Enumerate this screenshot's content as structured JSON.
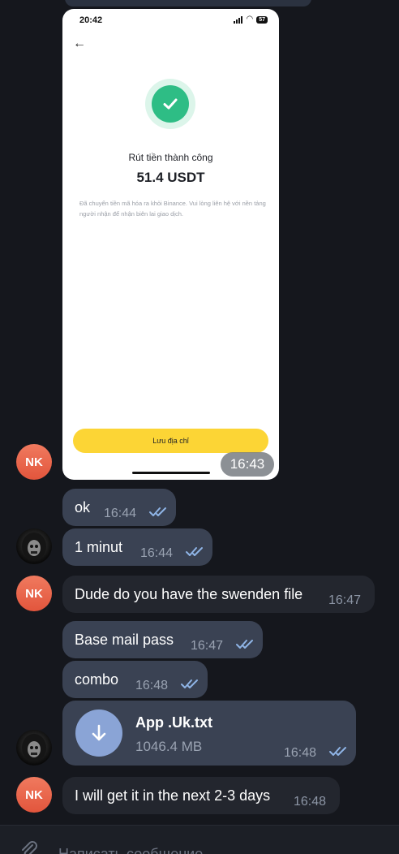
{
  "photo": {
    "status_time": "20:42",
    "battery": "57",
    "title": "Rút tiền thành công",
    "amount": "51.4 USDT",
    "description": "Đã chuyển tiền mã hóa ra khỏi Binance. Vui lòng liên hệ với nền tảng người nhận để nhận biên lai giao dịch.",
    "button_label": "Lưu địa chỉ",
    "time": "16:43"
  },
  "avatars": {
    "nk_initials": "NK"
  },
  "messages": [
    {
      "text": "ok",
      "time": "16:44",
      "outgoing": true
    },
    {
      "text": "1 minut",
      "time": "16:44",
      "outgoing": true
    },
    {
      "text": "Dude do you have the swenden file",
      "time": "16:47",
      "outgoing": false
    },
    {
      "text": "Base mail pass",
      "time": "16:47",
      "outgoing": true
    },
    {
      "text": "combo",
      "time": "16:48",
      "outgoing": true
    },
    {
      "text": "I will get it in the next 2-3 days",
      "time": "16:48",
      "outgoing": false
    }
  ],
  "file_message": {
    "name": "App .Uk.txt",
    "size": "1046.4 MB",
    "time": "16:48"
  },
  "input": {
    "placeholder": "Написать сообщение..."
  },
  "colors": {
    "background": "#15171d",
    "outgoing_bubble": "#3a4253",
    "incoming_bubble": "#23262e",
    "read_ticks": "#8fb4e6",
    "accent_yellow": "#fcd535",
    "success_green": "#2ebd85"
  }
}
